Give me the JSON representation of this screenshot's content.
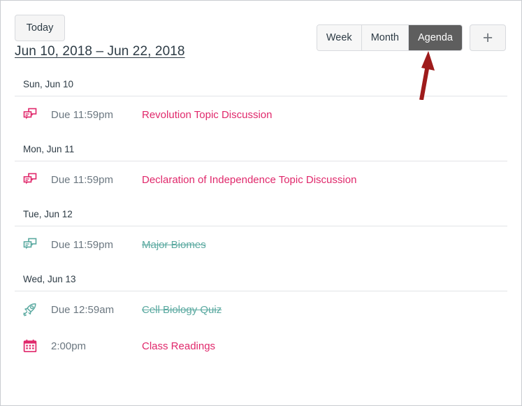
{
  "toolbar": {
    "today_label": "Today",
    "date_range": "Jun 10, 2018 – Jun 22, 2018",
    "views": [
      {
        "label": "Week",
        "active": false
      },
      {
        "label": "Month",
        "active": false
      },
      {
        "label": "Agenda",
        "active": true
      }
    ],
    "add_label": "+"
  },
  "colors": {
    "accent_pink": "#e0286b",
    "completed_teal": "#5aa9a0",
    "active_tab_bg": "#5e5e5e",
    "text_dark": "#2d3b45",
    "text_muted": "#6b7780",
    "annotation_red": "#9e1b1b"
  },
  "agenda": {
    "days": [
      {
        "header": "Sun, Jun 10",
        "events": [
          {
            "icon": "discussion-icon",
            "icon_color": "#e0286b",
            "time": "Due 11:59pm",
            "title": "Revolution Topic Discussion",
            "completed": false
          }
        ]
      },
      {
        "header": "Mon, Jun 11",
        "events": [
          {
            "icon": "discussion-icon",
            "icon_color": "#e0286b",
            "time": "Due 11:59pm",
            "title": "Declaration of Independence Topic Discussion",
            "completed": false
          }
        ]
      },
      {
        "header": "Tue, Jun 12",
        "events": [
          {
            "icon": "discussion-icon",
            "icon_color": "#5aa9a0",
            "time": "Due 11:59pm",
            "title": "Major Biomes",
            "completed": true
          }
        ]
      },
      {
        "header": "Wed, Jun 13",
        "events": [
          {
            "icon": "quiz-rocket-icon",
            "icon_color": "#5aa9a0",
            "time": "Due 12:59am",
            "title": "Cell Biology Quiz",
            "completed": true
          },
          {
            "icon": "calendar-event-icon",
            "icon_color": "#e0286b",
            "time": "2:00pm",
            "title": "Class Readings",
            "completed": false
          }
        ]
      }
    ]
  }
}
